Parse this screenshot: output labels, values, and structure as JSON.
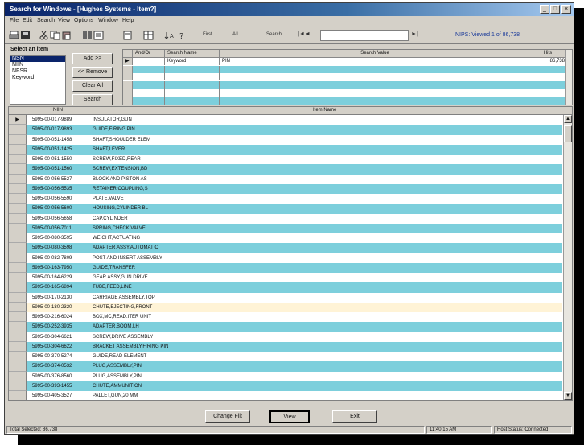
{
  "window": {
    "title": "Search for Windows - [Hughes Systems - Item?]"
  },
  "menu": [
    "File",
    "Edit",
    "Search",
    "View",
    "Options",
    "Window",
    "Help"
  ],
  "toolbar": {
    "icons": [
      "print-icon",
      "save-icon",
      "cut-icon",
      "copy-icon",
      "paste-icon",
      "find-icon",
      "filter-icon",
      "page-icon",
      "grid-icon",
      "sort-icon",
      "help-icon"
    ],
    "first_label": "First",
    "all_label": "All",
    "search_label": "Search",
    "status": "NIPS: Viewed 1 of 86,738"
  },
  "left_panel": {
    "label": "Select an item",
    "items": [
      {
        "label": "NSN",
        "selected": true
      },
      {
        "label": "NIIN",
        "selected": false
      },
      {
        "label": "NFSR",
        "selected": false
      },
      {
        "label": "Keyword",
        "selected": false
      }
    ]
  },
  "buttons": {
    "add": "Add >>",
    "remove": "<< Remove",
    "clear_all": "Clear All",
    "search": "Search"
  },
  "criteria": {
    "headers": [
      "And/Or",
      "Search Name",
      "Search Value",
      "Hits"
    ],
    "rows": [
      {
        "andor": "",
        "name": "Keyword",
        "value": "PIN",
        "hits": "86,738"
      },
      {
        "andor": "",
        "name": "",
        "value": "",
        "hits": ""
      },
      {
        "andor": "",
        "name": "",
        "value": "",
        "hits": ""
      },
      {
        "andor": "",
        "name": "",
        "value": "",
        "hits": ""
      },
      {
        "andor": "",
        "name": "",
        "value": "",
        "hits": ""
      },
      {
        "andor": "",
        "name": "",
        "value": "",
        "hits": ""
      }
    ]
  },
  "grid": {
    "headers": [
      "NIIN",
      "Item Name"
    ],
    "rows": [
      {
        "niin": "5995-00-017-9889",
        "name": "INSULATOR,GUN"
      },
      {
        "niin": "5995-00-017-9893",
        "name": "GUIDE,FIRING PIN"
      },
      {
        "niin": "5995-00-051-1458",
        "name": "SHAFT,SHOULDER ELEM"
      },
      {
        "niin": "5995-00-051-1425",
        "name": "SHAFT,LEVER"
      },
      {
        "niin": "5995-00-051-1550",
        "name": "SCREW,FIXED,REAR"
      },
      {
        "niin": "5995-00-051-1560",
        "name": "SCREW,EXTENSION,BD"
      },
      {
        "niin": "5995-00-056-5527",
        "name": "BLOCK AND PISTON AS"
      },
      {
        "niin": "5995-00-056-5535",
        "name": "RETAINER,COUPLING,S"
      },
      {
        "niin": "5995-00-056-5590",
        "name": "PLATE,VALVE"
      },
      {
        "niin": "5995-00-056-5600",
        "name": "HOUSING,CYLINDER BL"
      },
      {
        "niin": "5995-00-056-5658",
        "name": "CAP,CYLINDER"
      },
      {
        "niin": "5995-00-056-7011",
        "name": "SPRING,CHECK VALVE"
      },
      {
        "niin": "5995-00-080-3595",
        "name": "WEIGHT,ACTUATING"
      },
      {
        "niin": "5995-00-080-3598",
        "name": "ADAPTER,ASSY,AUTOMATIC"
      },
      {
        "niin": "5995-00-082-7809",
        "name": "POST AND INSERT ASSEMBLY"
      },
      {
        "niin": "5995-00-163-7950",
        "name": "GUIDE,TRANSFER"
      },
      {
        "niin": "5995-00-164-6229",
        "name": "GEAR ASSY,GUN DRIVE"
      },
      {
        "niin": "5995-00-165-6894",
        "name": "TUBE,FEED,LINE"
      },
      {
        "niin": "5995-00-170-2130",
        "name": "CARRIAGE ASSEMBLY,TOP"
      },
      {
        "niin": "5995-00-180-2320",
        "name": "CHUTE,EJECTING,FRONT"
      },
      {
        "niin": "5995-00-216-6024",
        "name": "BOX,MC,READ.ITER UNIT"
      },
      {
        "niin": "5995-00-252-3935",
        "name": "ADAPTER,BOOM,LH"
      },
      {
        "niin": "5995-00-304-6621",
        "name": "SCREW,DRIVE ASSEMBLY"
      },
      {
        "niin": "5995-00-304-6622",
        "name": "BRACKET ASSEMBLY,FIRING PIN"
      },
      {
        "niin": "5995-00-370-5274",
        "name": "GUIDE,READ ELEMENT"
      },
      {
        "niin": "5995-00-374-0532",
        "name": "PLUG,ASSEMBLY,PIN"
      },
      {
        "niin": "5995-00-376-8560",
        "name": "PLUG,ASSEMBLY,PIN"
      },
      {
        "niin": "5995-00-393-1455",
        "name": "CHUTE,AMMUNITION"
      },
      {
        "niin": "5995-00-405-3527",
        "name": "PALLET,GUN,20 MM"
      }
    ]
  },
  "bottom_buttons": {
    "change": "Change Filt",
    "view": "View",
    "exit": "Exit"
  },
  "statusbar": {
    "total": "Total Selected: 86,738",
    "time": "11:40:15 AM",
    "host": "Host Status: Connected"
  },
  "colors": {
    "stripe": "#7dcfdc",
    "highlight": "#fff3d6",
    "title": "#0a246a",
    "status_text": "#1a3a9a"
  }
}
